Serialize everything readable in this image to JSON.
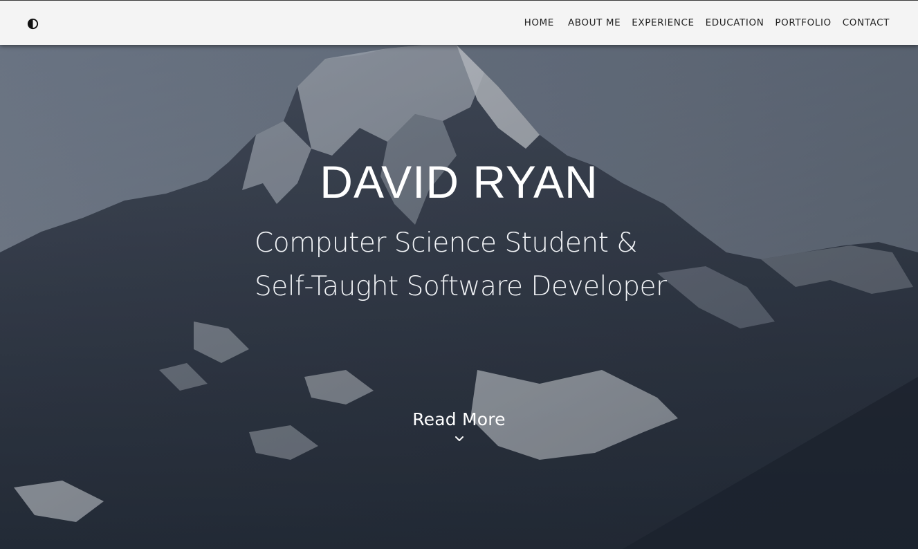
{
  "nav": {
    "theme_toggle_icon": "half-circle-contrast-icon",
    "links": [
      "HOME",
      "ABOUT ME",
      "EXPERIENCE",
      "EDUCATION",
      "PORTFOLIO",
      "CONTACT"
    ]
  },
  "hero": {
    "name": "DAVID RYAN",
    "subtitle_line1": "Computer Science Student &",
    "subtitle_line2": "Self-Taught Software Developer",
    "read_more_label": "Read More",
    "read_more_icon": "chevron-down-icon",
    "background": "snowy-mountain-photo"
  },
  "colors": {
    "navbar_bg": "#f4f4f4",
    "nav_text": "#222222",
    "hero_text": "#ffffff"
  }
}
